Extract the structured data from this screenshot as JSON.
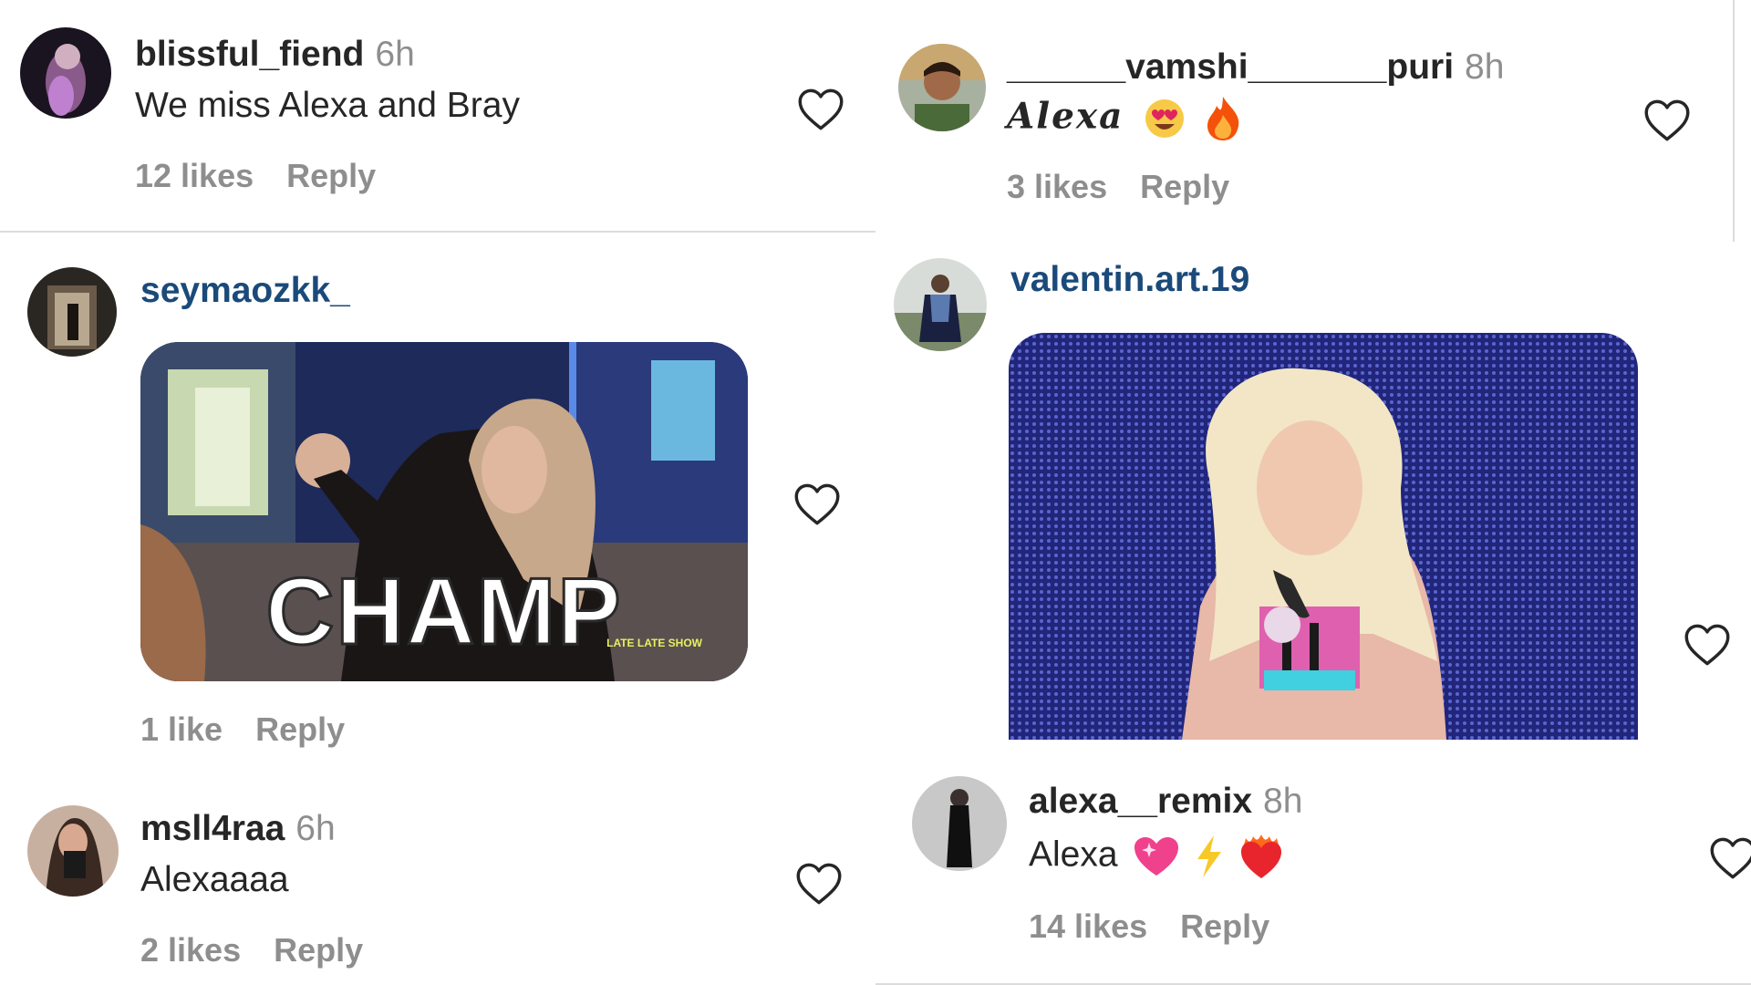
{
  "comments": [
    {
      "username": "blissful_fiend",
      "time": "6h",
      "text": "We miss Alexa and Bray",
      "likes": "12 likes",
      "reply": "Reply",
      "avatar": "avatar"
    },
    {
      "username": "______vamshi_______puri",
      "time": "8h",
      "text": "Alexa",
      "emoji": [
        "heart-eyes-emoji",
        "fire-emoji"
      ],
      "likes": "3 likes",
      "reply": "Reply",
      "avatar": "avatar"
    },
    {
      "username": "seymaozkk_",
      "gif_caption": "CHAMP",
      "gif_watermark": "LATE LATE SHOW",
      "likes": "1 like",
      "reply": "Reply",
      "avatar": "avatar"
    },
    {
      "username": "valentin.art.19",
      "gif": "wrestler-gif",
      "avatar": "avatar"
    },
    {
      "username": "msll4raa",
      "time": "6h",
      "text": "Alexaaaa",
      "likes": "2 likes",
      "reply": "Reply",
      "avatar": "avatar"
    },
    {
      "username": "alexa__remix",
      "time": "8h",
      "text": "Alexa",
      "emoji": [
        "sparkling-heart-emoji",
        "lightning-emoji",
        "heart-on-fire-emoji"
      ],
      "likes": "14 likes",
      "reply": "Reply",
      "avatar": "avatar"
    }
  ],
  "icons": {
    "like": "heart-outline-icon"
  },
  "colors": {
    "username": "#262626",
    "meta": "#8e8e8e",
    "link_username": "#1a4a7a"
  }
}
